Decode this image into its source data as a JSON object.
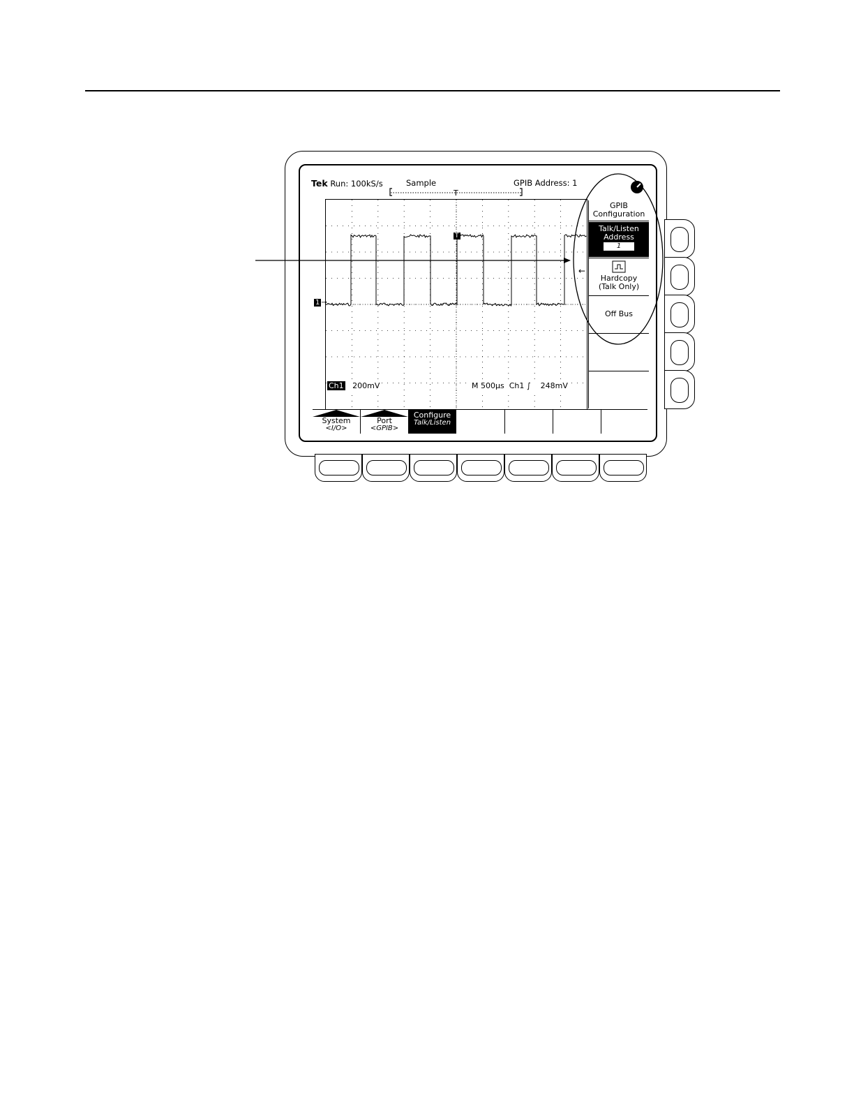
{
  "status_bar": {
    "brand": "Tek",
    "run_state": "Run: 100kS/s",
    "acq_mode": "Sample",
    "gpib_address": "GPIB Address: 1"
  },
  "waveform": {
    "channel_marker": "1",
    "trigger_marker": "T"
  },
  "readouts": {
    "ch_label": "Ch1",
    "ch_scale": "200mV",
    "timebase": "M  500µs",
    "trigger_source": "Ch1",
    "trigger_slope": "∫",
    "trigger_level": "248mV"
  },
  "side_menu": {
    "title_line1": "GPIB",
    "title_line2": "Configuration",
    "item1_line1": "Talk/Listen",
    "item1_line2": "Address",
    "item1_value": "1",
    "item2_line1": "Hardcopy",
    "item2_line2": "(Talk Only)",
    "item3": "Off Bus"
  },
  "bottom_menu": {
    "system_label": "System",
    "system_value": "<I/O>",
    "port_label": "Port",
    "port_value": "<GPIB>",
    "configure_label": "Configure",
    "configure_value": "Talk/Listen"
  }
}
